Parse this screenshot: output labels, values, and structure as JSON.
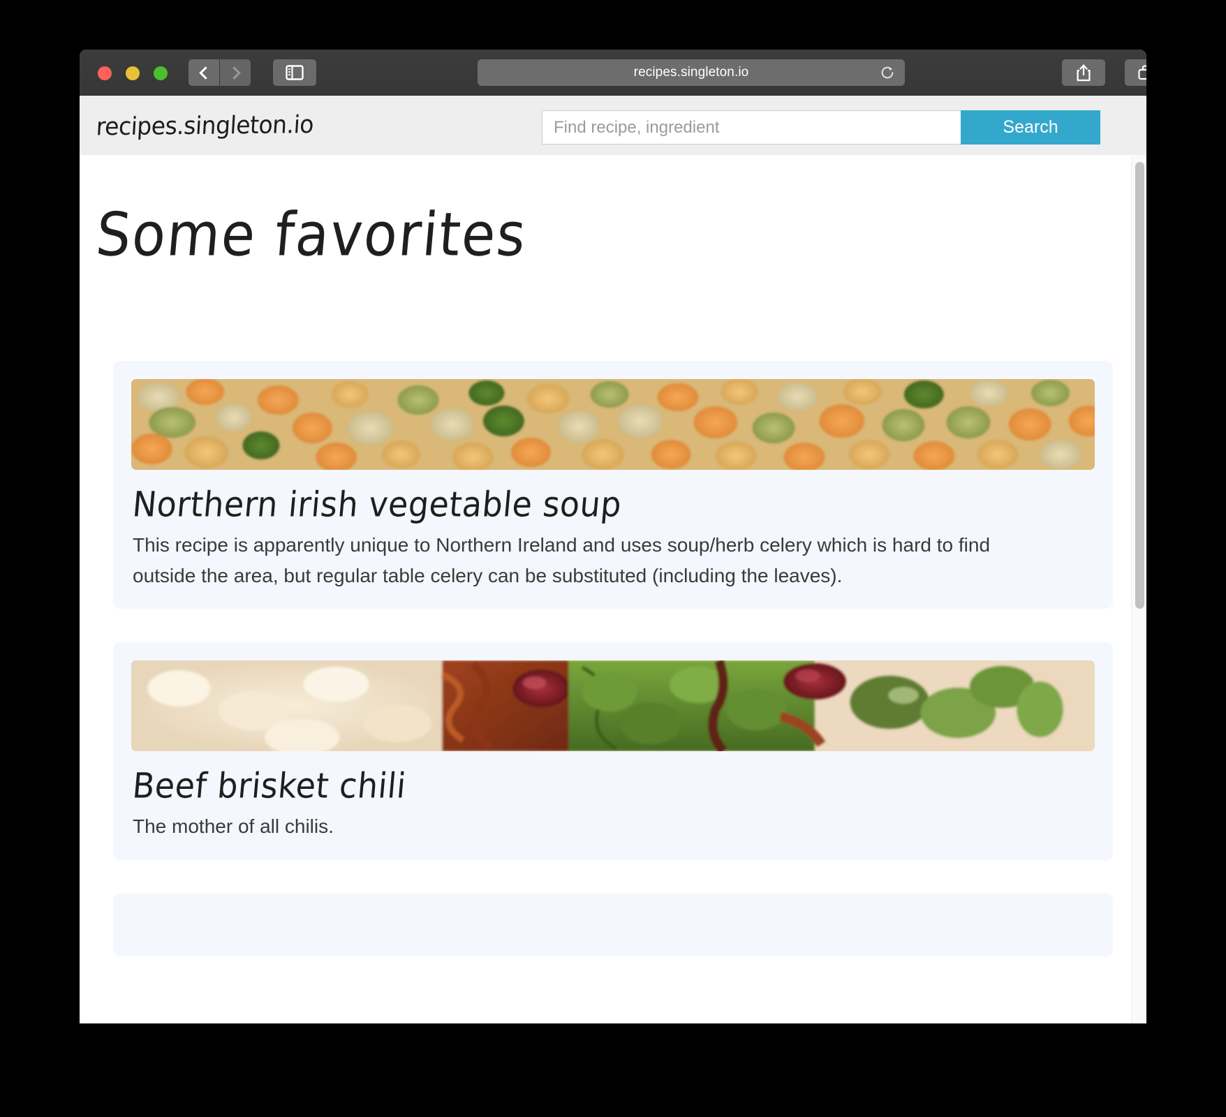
{
  "browser": {
    "url": "recipes.singleton.io",
    "traffic_lights": [
      "close",
      "minimize",
      "zoom"
    ],
    "back_icon": "chevron-left-icon",
    "forward_icon": "chevron-right-icon",
    "sidebar_icon": "sidebar-toggle-icon",
    "reload_icon": "reload-icon",
    "share_icon": "share-icon",
    "tabs_icon": "show-tabs-icon",
    "newtab_label": "+"
  },
  "site": {
    "brand": "recipes.singleton.io",
    "search": {
      "placeholder": "Find recipe, ingredient",
      "value": "",
      "button_label": "Search"
    }
  },
  "main": {
    "heading": "Some favorites",
    "cards": [
      {
        "title": "Northern irish vegetable soup",
        "description": "This recipe is apparently unique to Northern Ireland and uses soup/herb celery which is hard to find outside the area, but regular table celery can be substituted (including the leaves).",
        "image_alt": "dried-pulses-legumes-mix-photo"
      },
      {
        "title": "Beef brisket chili",
        "description": "The mother of all chilis.",
        "image_alt": "brisket-chili-with-rice-and-cilantro-photo"
      }
    ]
  },
  "colors": {
    "accent": "#34a8cc",
    "card_background": "#f4f7fd",
    "header_background": "#eeeeee",
    "titlebar_background": "#3a3a3a",
    "text": "#1f1f1f"
  },
  "scrollbar": {
    "orientation": "vertical",
    "position": "right"
  }
}
